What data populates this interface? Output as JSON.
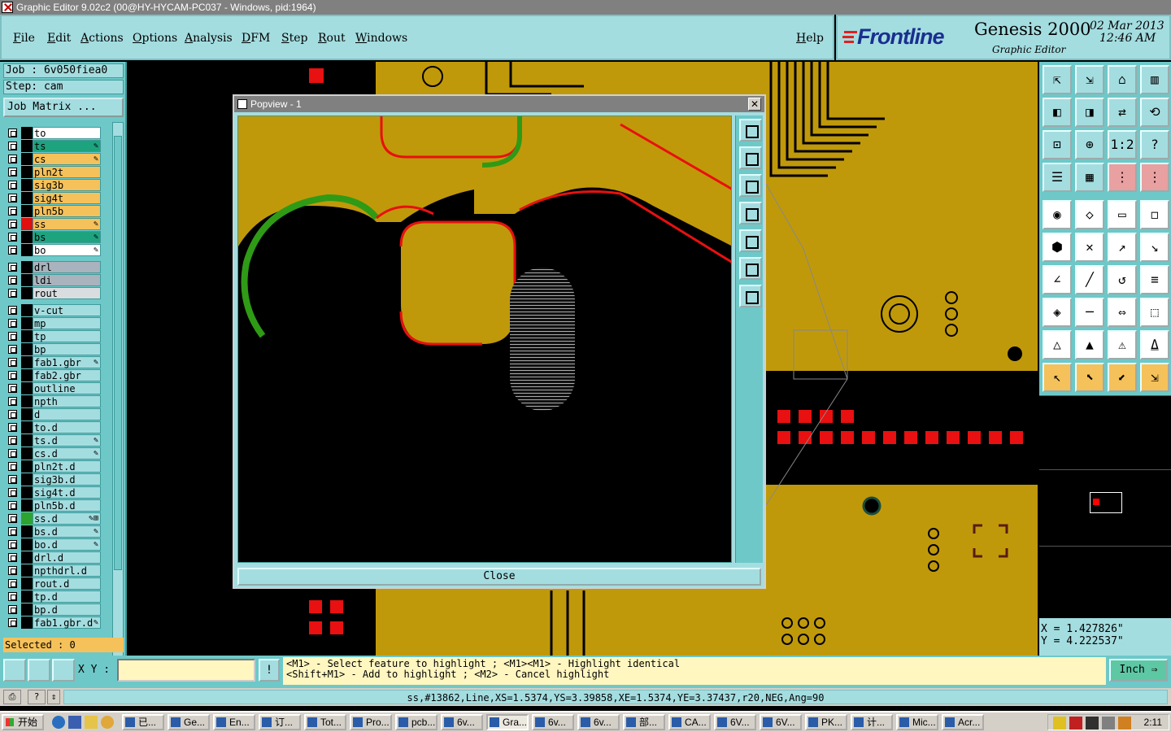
{
  "window": {
    "title": "Graphic Editor 9.02c2 (00@HY-HYCAM-PC037 - Windows, pid:1964)"
  },
  "menu": {
    "items": [
      "File",
      "Edit",
      "Actions",
      "Options",
      "Analysis",
      "DFM",
      "Step",
      "Rout",
      "Windows"
    ],
    "help": "Help"
  },
  "brand": {
    "logo": "Frontline",
    "product": "Genesis 2000",
    "subtitle": "Graphic Editor",
    "date": "02 Mar 2013",
    "time": "12:46 AM"
  },
  "job": {
    "job_label": "Job : 6v050fiea0",
    "step_label": "Step: cam",
    "matrix_button": "Job Matrix ..."
  },
  "layers": [
    {
      "name": "to",
      "bg": "#ffffff",
      "color": "#000000",
      "aff": ""
    },
    {
      "name": "ts",
      "bg": "#1ea37f",
      "color": "#000000",
      "aff": "✎"
    },
    {
      "name": "cs",
      "bg": "#f5c15a",
      "color": "#000000",
      "aff": "✎"
    },
    {
      "name": "pln2t",
      "bg": "#f5c15a",
      "color": "#000000",
      "aff": ""
    },
    {
      "name": "sig3b",
      "bg": "#f5c15a",
      "color": "#000000",
      "aff": ""
    },
    {
      "name": "sig4t",
      "bg": "#f5c15a",
      "color": "#000000",
      "aff": ""
    },
    {
      "name": "pln5b",
      "bg": "#f5c15a",
      "color": "#000000",
      "aff": ""
    },
    {
      "name": "ss",
      "bg": "#f5c15a",
      "color": "#e01010",
      "aff": "✎"
    },
    {
      "name": "bs",
      "bg": "#1ea37f",
      "color": "#000000",
      "aff": "✎"
    },
    {
      "name": "bo",
      "bg": "#ffffff",
      "color": "#000000",
      "aff": "✎"
    },
    {
      "name": "drl",
      "bg": "#a9b3bd",
      "color": "#000000",
      "aff": ""
    },
    {
      "name": "ldi",
      "bg": "#a9b3bd",
      "color": "#000000",
      "aff": ""
    },
    {
      "name": "rout",
      "bg": "#d9dde0",
      "color": "#000000",
      "aff": ""
    },
    {
      "name": "v-cut",
      "bg": "#a4dde0",
      "color": "#000000",
      "aff": ""
    },
    {
      "name": "mp",
      "bg": "#a4dde0",
      "color": "#000000",
      "aff": ""
    },
    {
      "name": "tp",
      "bg": "#a4dde0",
      "color": "#000000",
      "aff": ""
    },
    {
      "name": "bp",
      "bg": "#a4dde0",
      "color": "#000000",
      "aff": ""
    },
    {
      "name": "fab1.gbr",
      "bg": "#a4dde0",
      "color": "#000000",
      "aff": "✎"
    },
    {
      "name": "fab2.gbr",
      "bg": "#a4dde0",
      "color": "#000000",
      "aff": ""
    },
    {
      "name": "outline",
      "bg": "#a4dde0",
      "color": "#000000",
      "aff": ""
    },
    {
      "name": "npth",
      "bg": "#a4dde0",
      "color": "#000000",
      "aff": ""
    },
    {
      "name": "d",
      "bg": "#a4dde0",
      "color": "#000000",
      "aff": ""
    },
    {
      "name": "to.d",
      "bg": "#a4dde0",
      "color": "#000000",
      "aff": ""
    },
    {
      "name": "ts.d",
      "bg": "#a4dde0",
      "color": "#000000",
      "aff": "✎"
    },
    {
      "name": "cs.d",
      "bg": "#a4dde0",
      "color": "#000000",
      "aff": "✎"
    },
    {
      "name": "pln2t.d",
      "bg": "#a4dde0",
      "color": "#000000",
      "aff": ""
    },
    {
      "name": "sig3b.d",
      "bg": "#a4dde0",
      "color": "#000000",
      "aff": ""
    },
    {
      "name": "sig4t.d",
      "bg": "#a4dde0",
      "color": "#000000",
      "aff": ""
    },
    {
      "name": "pln5b.d",
      "bg": "#a4dde0",
      "color": "#000000",
      "aff": ""
    },
    {
      "name": "ss.d",
      "bg": "#a4dde0",
      "color": "#2fa32f",
      "aff": "✎⊞"
    },
    {
      "name": "bs.d",
      "bg": "#a4dde0",
      "color": "#000000",
      "aff": "✎"
    },
    {
      "name": "bo.d",
      "bg": "#a4dde0",
      "color": "#000000",
      "aff": "✎"
    },
    {
      "name": "drl.d",
      "bg": "#a4dde0",
      "color": "#000000",
      "aff": ""
    },
    {
      "name": "npthdrl.d",
      "bg": "#a4dde0",
      "color": "#000000",
      "aff": ""
    },
    {
      "name": "rout.d",
      "bg": "#a4dde0",
      "color": "#000000",
      "aff": ""
    },
    {
      "name": "tp.d",
      "bg": "#a4dde0",
      "color": "#000000",
      "aff": ""
    },
    {
      "name": "bp.d",
      "bg": "#a4dde0",
      "color": "#000000",
      "aff": ""
    },
    {
      "name": "fab1.gbr.d",
      "bg": "#a4dde0",
      "color": "#000000",
      "aff": "✎"
    }
  ],
  "selected": "Selected : 0",
  "popview": {
    "title": "Popview - 1",
    "close_label": "Close"
  },
  "coords": {
    "x": "X = 1.427826\"",
    "y": "Y = 4.222537\""
  },
  "bottom": {
    "xy_label": "X Y :",
    "xy_value": "",
    "warn": "!",
    "hint_line1": "<M1> - Select feature to highlight ; <M1><M1> - Highlight identical",
    "hint_line2": "<Shift+M1> - Add to highlight ; <M2> - Cancel highlight",
    "unit": "Inch",
    "status": "ss,#13862,Line,XS=1.5374,YS=3.39858,XE=1.5374,YE=3.37437,r20,NEG,Ang=90"
  },
  "taskbar": {
    "start": "开始",
    "tasks": [
      "已...",
      "Ge...",
      "En...",
      "订...",
      "Tot...",
      "Pro...",
      "pcb...",
      "6v...",
      "Gra...",
      "6v...",
      "6v...",
      "部...",
      "CA...",
      "6V...",
      "6V...",
      "PK...",
      "计...",
      "Mic...",
      "Acr..."
    ],
    "clock": "2:11"
  }
}
